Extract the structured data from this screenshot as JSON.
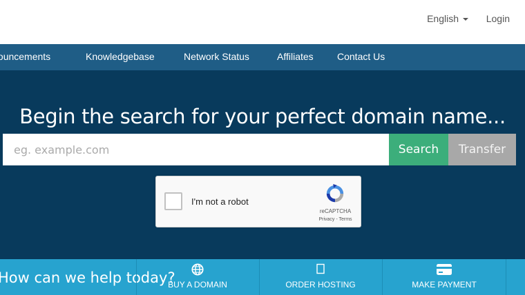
{
  "header": {
    "language_label": "English",
    "login_label": "Login"
  },
  "nav": {
    "items": [
      {
        "label": "Announcements"
      },
      {
        "label": "Knowledgebase"
      },
      {
        "label": "Network Status"
      },
      {
        "label": "Affiliates"
      },
      {
        "label": "Contact Us"
      }
    ]
  },
  "hero": {
    "title": "Begin the search for your perfect domain name...",
    "search_placeholder": "eg. example.com",
    "search_value": "",
    "search_button": "Search",
    "transfer_button": "Transfer"
  },
  "recaptcha": {
    "label": "I'm not a robot",
    "brand": "reCAPTCHA",
    "links": "Privacy - Terms",
    "checked": false
  },
  "bottom": {
    "help_text": "How can we help today?",
    "actions": [
      {
        "label": "BUY A DOMAIN",
        "icon": "globe-icon"
      },
      {
        "label": "ORDER HOSTING",
        "icon": "box-icon"
      },
      {
        "label": "MAKE PAYMENT",
        "icon": "credit-card-icon"
      }
    ]
  },
  "colors": {
    "nav_bg": "#1f5d86",
    "hero_bg": "#083a5c",
    "search_btn": "#3cae7b",
    "transfer_btn": "#a8a8a8",
    "bottom_bar": "#27a3cf"
  }
}
